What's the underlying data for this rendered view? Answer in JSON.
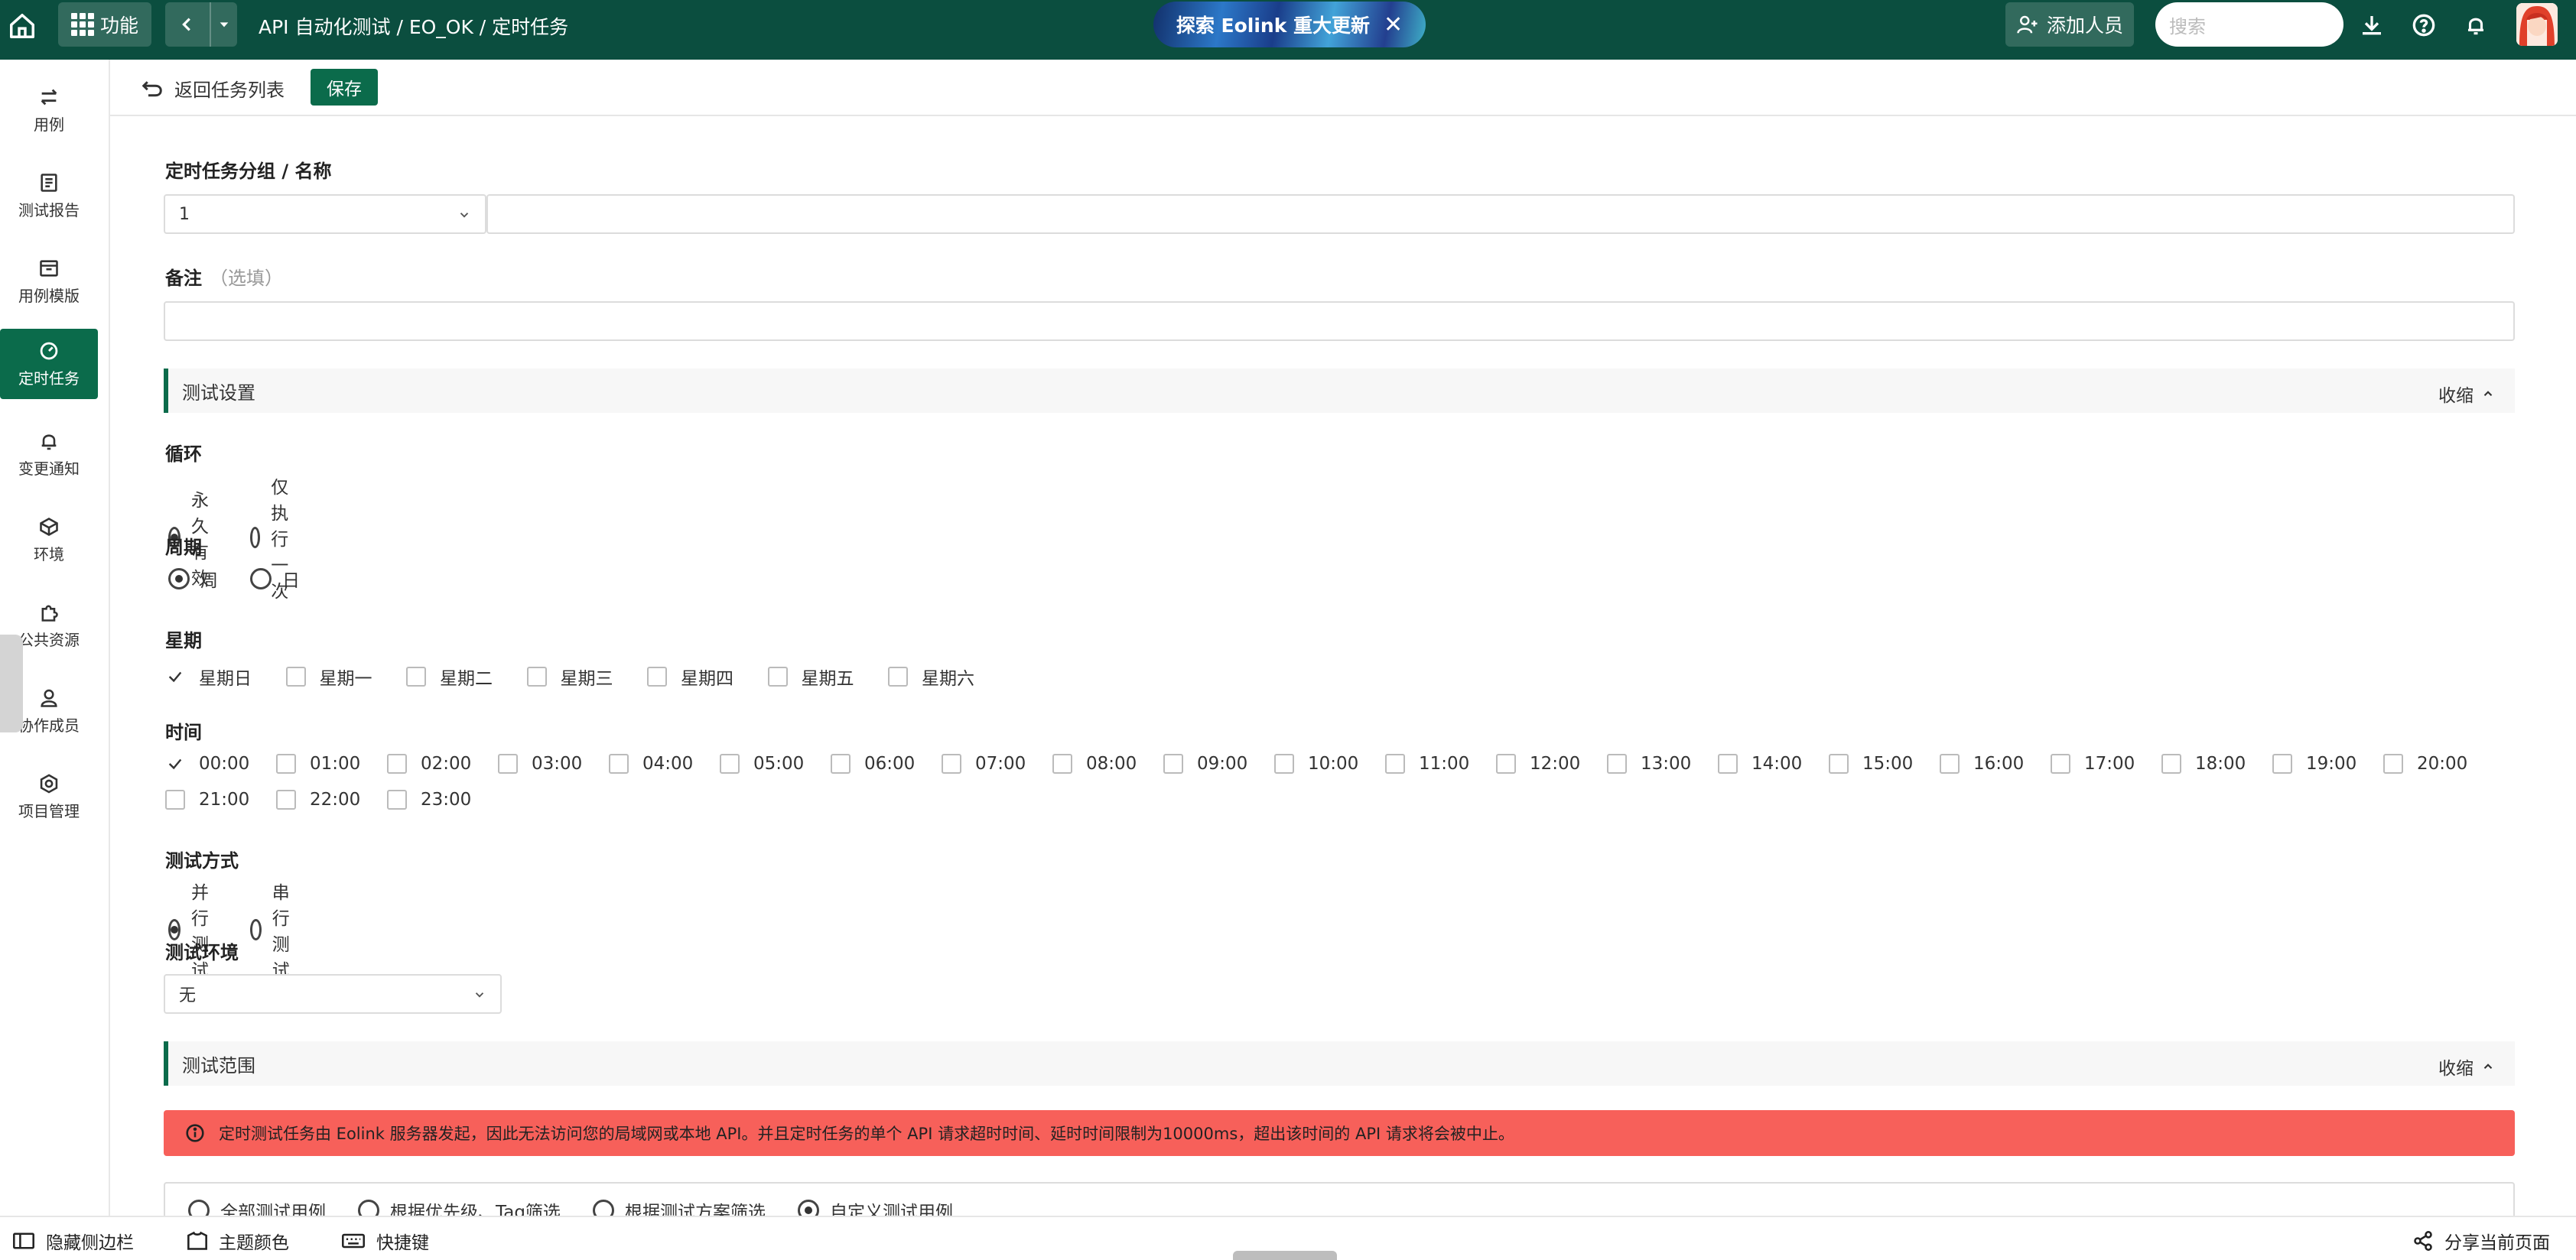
{
  "topbar": {
    "func_label": "功能",
    "breadcrumb": "API 自动化测试  / EO_OK / 定时任务",
    "banner_text": "探索 Eolink 重大更新",
    "add_member_label": "添加人员",
    "search_placeholder": "搜索"
  },
  "sidebar": {
    "items": [
      {
        "label": "用例",
        "icon": "swap-arrows-icon"
      },
      {
        "label": "测试报告",
        "icon": "report-icon"
      },
      {
        "label": "用例模版",
        "icon": "template-icon"
      },
      {
        "label": "定时任务",
        "icon": "timer-icon",
        "active": true
      },
      {
        "label": "变更通知",
        "icon": "bell-icon"
      },
      {
        "label": "环境",
        "icon": "environment-icon"
      },
      {
        "label": "公共资源",
        "icon": "puzzle-icon"
      },
      {
        "label": "协作成员",
        "icon": "member-icon"
      },
      {
        "label": "项目管理",
        "icon": "settings-icon"
      }
    ]
  },
  "actionbar": {
    "return_label": "返回任务列表",
    "save_label": "保存"
  },
  "form": {
    "group_name_label": "定时任务分组 / 名称",
    "group_value": "1",
    "name_value": "",
    "remark_label": "备注",
    "remark_optional": "（选填）",
    "remark_value": "",
    "test_settings_title": "测试设置",
    "collapse_label": "收缩",
    "loop": {
      "label": "循环",
      "options": [
        "永久有效",
        "仅执行一次"
      ],
      "selected": "永久有效"
    },
    "period": {
      "label": "周期",
      "options": [
        "周",
        "日"
      ],
      "selected": "周"
    },
    "weekday": {
      "label": "星期",
      "options": [
        "星期日",
        "星期一",
        "星期二",
        "星期三",
        "星期四",
        "星期五",
        "星期六"
      ],
      "checked": [
        "星期日"
      ]
    },
    "time": {
      "label": "时间",
      "options": [
        "00:00",
        "01:00",
        "02:00",
        "03:00",
        "04:00",
        "05:00",
        "06:00",
        "07:00",
        "08:00",
        "09:00",
        "10:00",
        "11:00",
        "12:00",
        "13:00",
        "14:00",
        "15:00",
        "16:00",
        "17:00",
        "18:00",
        "19:00",
        "20:00",
        "21:00",
        "22:00",
        "23:00"
      ],
      "checked": [
        "00:00"
      ]
    },
    "mode": {
      "label": "测试方式",
      "options": [
        "并行测试",
        "串行测试"
      ],
      "selected": "并行测试"
    },
    "env": {
      "label": "测试环境",
      "value": "无"
    },
    "test_scope_title": "测试范围",
    "alert_text": "定时测试任务由 Eolink 服务器发起，因此无法访问您的局域网或本地 API。并且定时任务的单个 API 请求超时时间、延时时间限制为10000ms，超出该时间的 API 请求将会被中止。",
    "scope": {
      "options": [
        "全部测试用例",
        "根据优先级、Tag筛选",
        "根据测试方案筛选",
        "自定义测试用例"
      ],
      "selected": "自定义测试用例"
    }
  },
  "bottombar": {
    "hide_sidebar_label": "隐藏侧边栏",
    "theme_label": "主题颜色",
    "shortcut_label": "快捷键",
    "share_label": "分享当前页面"
  },
  "colors": {
    "topbar_bg": "#0b4e3f",
    "accent": "#0b6b4b",
    "alert_bg": "#f7605a"
  }
}
